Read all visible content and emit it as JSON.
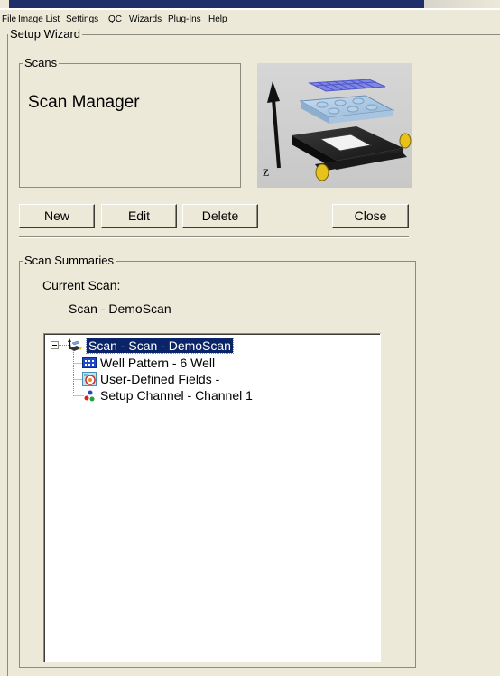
{
  "menubar": {
    "items": [
      "File",
      "Image List",
      "Settings",
      "QC",
      "Wizards",
      "Plug-Ins",
      "Help"
    ]
  },
  "wizard": {
    "title": "Setup Wizard"
  },
  "scans": {
    "group_title": "Scans",
    "heading": "Scan Manager",
    "preview_icon": "microscope-stage-z-axis-image"
  },
  "buttons": {
    "new": "New",
    "edit": "Edit",
    "delete": "Delete",
    "close": "Close"
  },
  "summaries": {
    "group_title": "Scan Summaries",
    "current_scan_label": "Current Scan:",
    "current_scan_value": "Scan - DemoScan",
    "tree": {
      "root": {
        "label": "Scan - Scan - DemoScan",
        "icon": "scan-microscope-icon",
        "expanded": true,
        "selected": true
      },
      "children": [
        {
          "label": "Well Pattern - 6 Well",
          "icon": "well-plate-icon"
        },
        {
          "label": "User-Defined Fields - ",
          "icon": "user-defined-fields-icon"
        },
        {
          "label": "Setup Channel - Channel 1",
          "icon": "color-channel-dots-icon"
        }
      ]
    }
  },
  "colors": {
    "window_background": "#ece9d8",
    "selection_background": "#0a246a",
    "selection_text": "#ffffff",
    "tree_background": "#ffffff",
    "groupbox_border": "#8d8a7f",
    "well_plate_blue": "#1f49c8",
    "stage_yellow": "#e6c21a"
  }
}
